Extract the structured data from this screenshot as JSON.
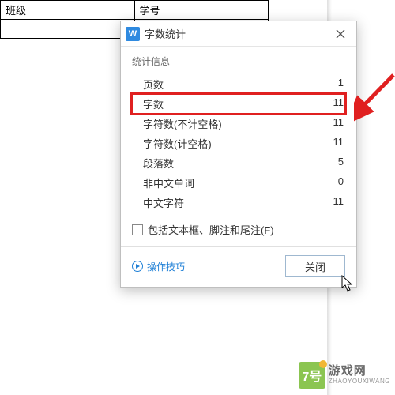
{
  "background": {
    "table_headers": [
      "班级",
      "学号"
    ]
  },
  "dialog": {
    "app_icon_letter": "W",
    "title": "字数统计",
    "section_label": "统计信息",
    "stats": [
      {
        "label": "页数",
        "value": "1"
      },
      {
        "label": "字数",
        "value": "11"
      },
      {
        "label": "字符数(不计空格)",
        "value": "11"
      },
      {
        "label": "字符数(计空格)",
        "value": "11"
      },
      {
        "label": "段落数",
        "value": "5"
      },
      {
        "label": "非中文单词",
        "value": "0"
      },
      {
        "label": "中文字符",
        "value": "11"
      }
    ],
    "checkbox_label": "包括文本框、脚注和尾注(F)",
    "tips_label": "操作技巧",
    "close_button": "关闭"
  },
  "watermark": {
    "badge": "7号",
    "cn": "游戏网",
    "py": "ZHAOYOUXIWANG"
  }
}
